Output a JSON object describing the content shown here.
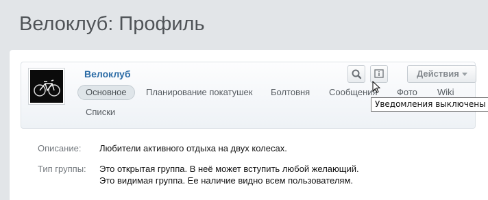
{
  "page": {
    "title": "Велоклуб: Профиль"
  },
  "group": {
    "name": "Велоклуб"
  },
  "tabs": [
    {
      "label": "Основное"
    },
    {
      "label": "Планирование покатушек"
    },
    {
      "label": "Болтовня"
    },
    {
      "label": "Сообщения"
    },
    {
      "label": "Фото"
    },
    {
      "label": "Wiki"
    },
    {
      "label": "Списки"
    }
  ],
  "toolbar": {
    "search_icon": "search-icon",
    "notify_icon": "notification-info-icon",
    "actions_label": "Действия"
  },
  "tooltip": {
    "text": "Уведомления выключены"
  },
  "info": {
    "description_label": "Описание:",
    "description_value": "Любители активного отдыха на двух колесах.",
    "type_label": "Тип группы:",
    "type_line1": "Это открытая группа. В неё может вступить любой желающий.",
    "type_line2": "Это видимая группа. Ее наличие видно всем пользователям."
  },
  "colors": {
    "link": "#2b6ba5",
    "background": "#e2e5e8"
  }
}
